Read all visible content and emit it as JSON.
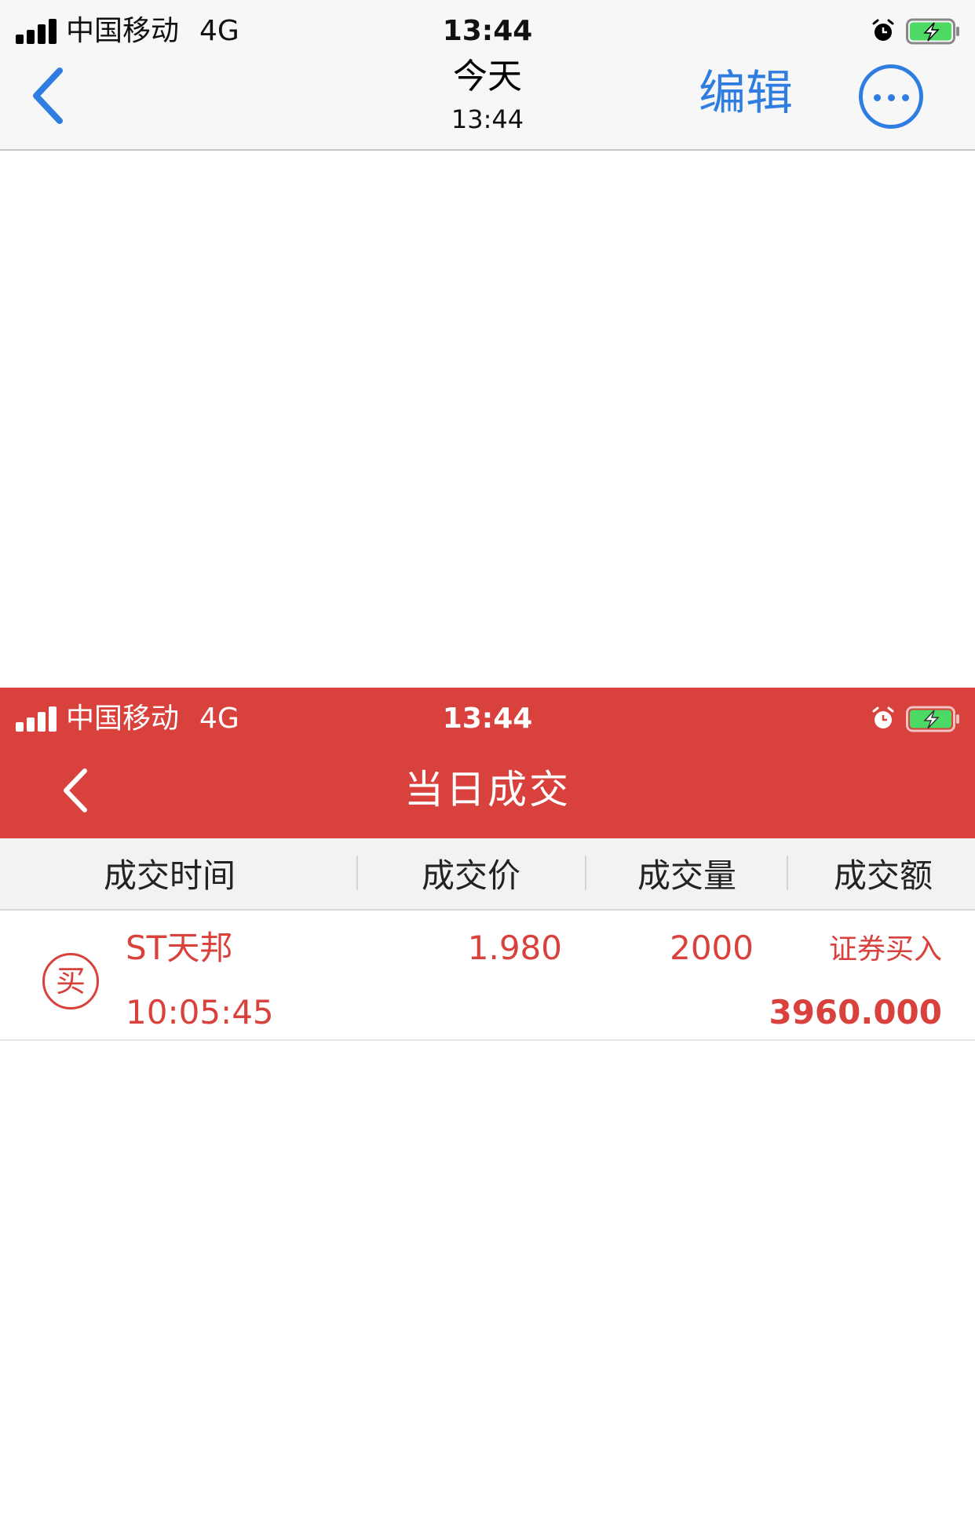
{
  "viewer": {
    "status_bar": {
      "carrier": "中国移动",
      "network": "4G",
      "time": "13:44"
    },
    "nav": {
      "title": "今天",
      "subtitle": "13:44",
      "edit_label": "编辑"
    },
    "colors": {
      "accent": "#2f7de1",
      "bar_bg": "#f7f7f7"
    }
  },
  "app": {
    "status_bar": {
      "carrier": "中国移动",
      "network": "4G",
      "time": "13:44"
    },
    "header": {
      "title": "当日成交"
    },
    "table": {
      "columns": [
        "成交时间",
        "成交价",
        "成交量",
        "成交额"
      ],
      "rows": [
        {
          "badge": "买",
          "name": "ST天邦",
          "time": "10:05:45",
          "price": "1.980",
          "quantity": "2000",
          "type": "证券买入",
          "amount": "3960.000"
        }
      ]
    },
    "colors": {
      "brand": "#d8413c",
      "battery_green": "#4cd964"
    }
  }
}
